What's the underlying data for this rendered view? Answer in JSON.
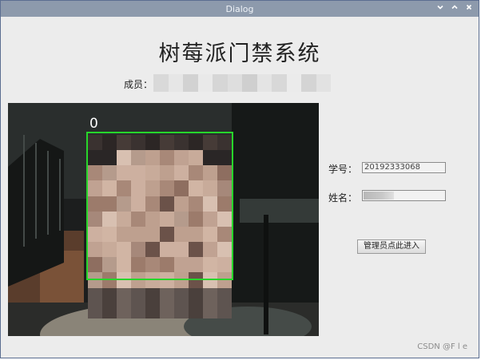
{
  "window": {
    "title": "Dialog"
  },
  "heading": "树莓派门禁系统",
  "member": {
    "label": "成员："
  },
  "camera": {
    "face_id": "0"
  },
  "form": {
    "student_id_label": "学号：",
    "student_id_value": "20192333068",
    "name_label": "姓名："
  },
  "admin_button": "管理员点此进入",
  "watermark": "CSDN @F l e"
}
